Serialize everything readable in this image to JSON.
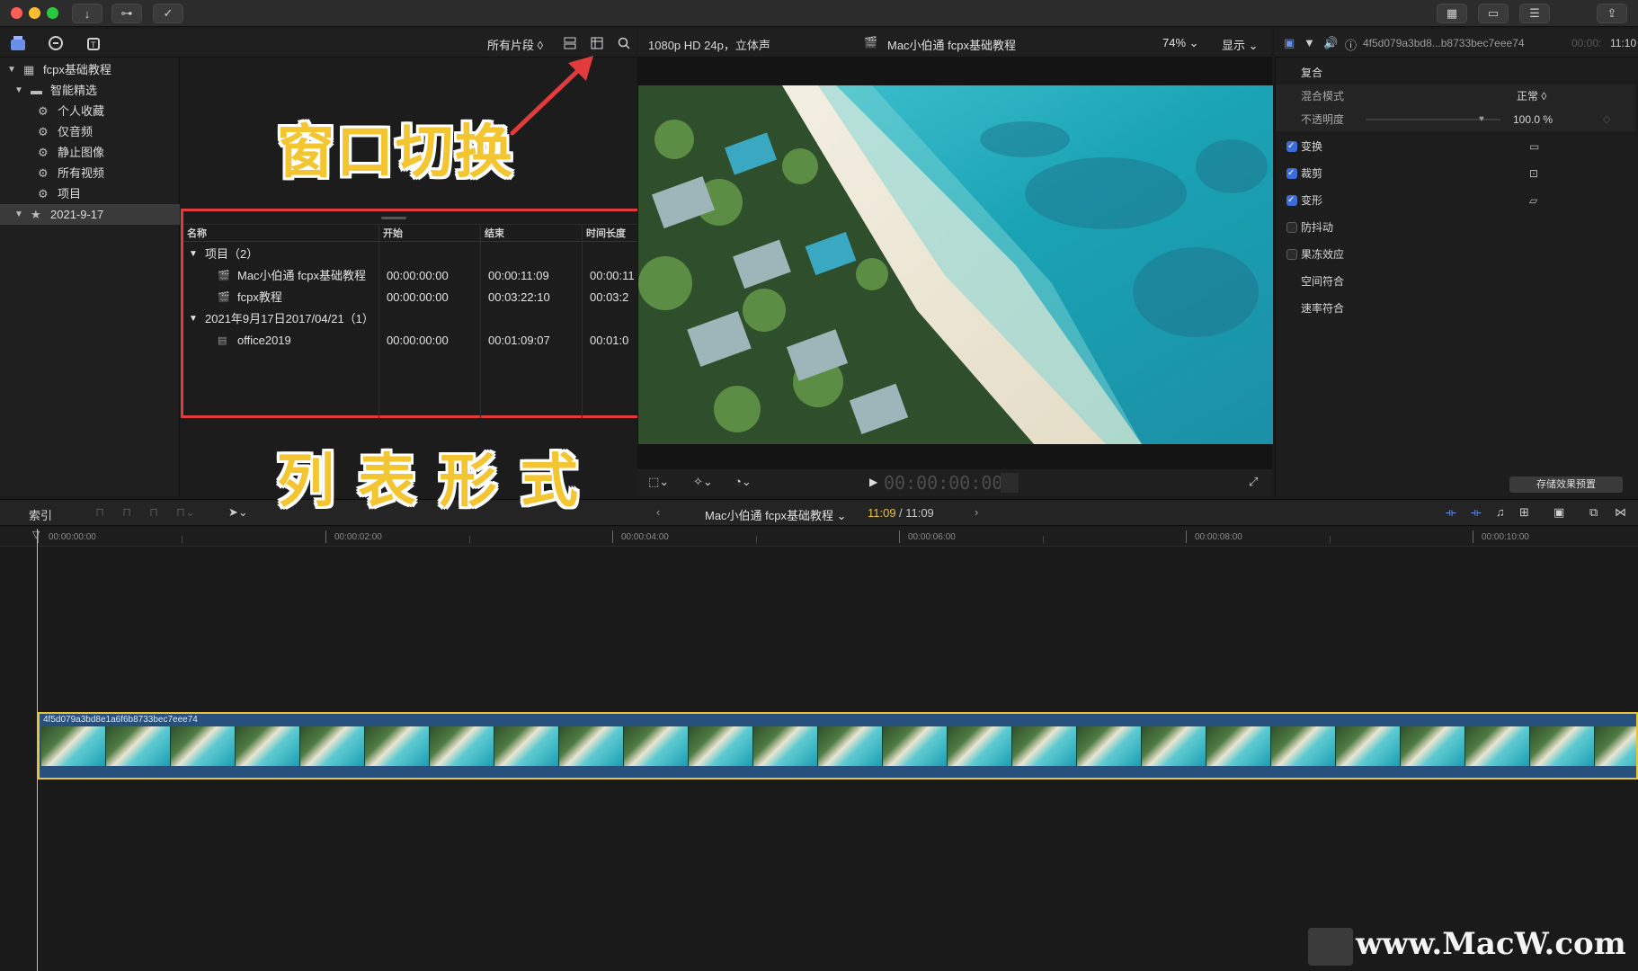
{
  "toolbar": {
    "buttons": [
      "↓",
      "⊶",
      "✓"
    ],
    "right_buttons": [
      "▦",
      "▭",
      "☰",
      "⇪"
    ]
  },
  "library": {
    "filter": "所有片段 ◊",
    "root": "fcpx基础教程",
    "smart_collections": "智能精选",
    "items": [
      "个人收藏",
      "仅音频",
      "静止图像",
      "所有视频",
      "项目"
    ],
    "event": "2021-9-17"
  },
  "list": {
    "headers": [
      "名称",
      "开始",
      "结束",
      "时间长度"
    ],
    "groups": [
      {
        "label": "项目（2）"
      },
      {
        "label": "2021年9月17日2017/04/21（1）"
      }
    ],
    "rows": [
      {
        "name": "Mac小伯通 fcpx基础教程",
        "start": "00:00:00:00",
        "end": "00:00:11:09",
        "dur": "00:00:11"
      },
      {
        "name": "fcpx教程",
        "start": "00:00:00:00",
        "end": "00:03:22:10",
        "dur": "00:03:2"
      },
      {
        "name": "office2019",
        "start": "00:00:00:00",
        "end": "00:01:09:07",
        "dur": "00:01:0"
      }
    ]
  },
  "viewer": {
    "format": "1080p HD 24p，立体声",
    "title": "Mac小伯通 fcpx基础教程",
    "zoom": "74% ⌄",
    "display": "显示 ⌄",
    "timecode": "00:00:00:00"
  },
  "inspector": {
    "clip_id": "4f5d079a3bd8...b8733bec7eee74",
    "duration": "11:10",
    "duration_prefix": "00:00:",
    "section": "复合",
    "blend_label": "混合模式",
    "blend_value": "正常 ◊",
    "opacity_label": "不透明度",
    "opacity_value": "100.0 %",
    "rows": [
      "变换",
      "裁剪",
      "变形",
      "防抖动",
      "果冻效应",
      "空间符合",
      "速率符合"
    ],
    "save_preset": "存储效果预置"
  },
  "timeline": {
    "index": "索引",
    "project": "Mac小伯通 fcpx基础教程 ⌄",
    "time_current": "11:09",
    "time_total": " / 11:09",
    "ticks": [
      "00:00:00:00",
      "00:00:02:00",
      "00:00:04:00",
      "00:00:06:00",
      "00:00:08:00",
      "00:00:10:00"
    ],
    "clip_label": "4f5d079a3bd8e1a6f6b8733bec7eee74"
  },
  "annotations": {
    "window_switch": "窗口切换",
    "list_format": "列 表 形 式"
  },
  "watermark": "www.MacW.com",
  "colors": {
    "accent_red": "#e23b3b",
    "annotation_yellow": "#f2c531",
    "clip_border": "#e7c23a",
    "clip_fill": "#27507d"
  }
}
